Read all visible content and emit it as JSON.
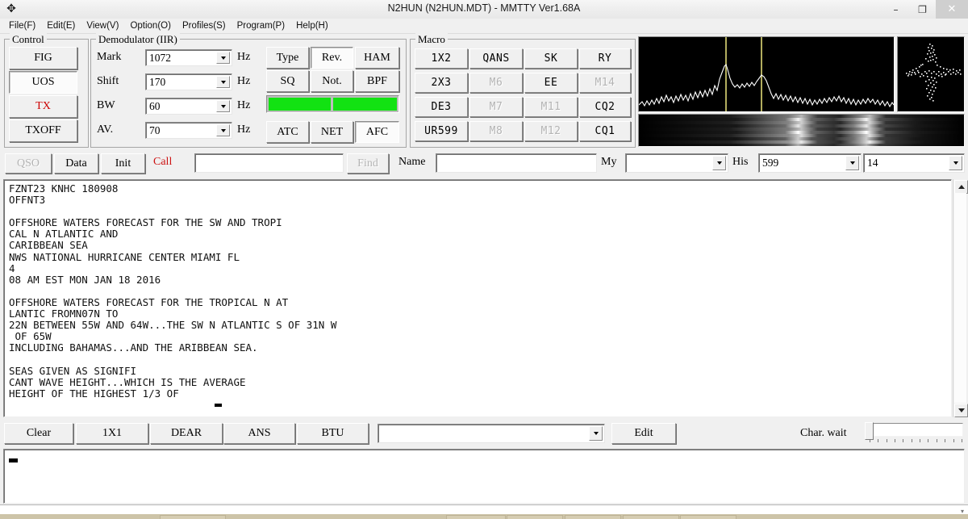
{
  "window": {
    "icon": "move-crosshair-icon",
    "title": "N2HUN (N2HUN.MDT) - MMTTY Ver1.68A",
    "minimize": "–",
    "maximize": "❐",
    "close": "✕"
  },
  "menu": {
    "items": [
      {
        "label": "File(F)"
      },
      {
        "label": "Edit(E)"
      },
      {
        "label": "View(V)"
      },
      {
        "label": "Option(O)"
      },
      {
        "label": "Profiles(S)"
      },
      {
        "label": "Program(P)"
      },
      {
        "label": "Help(H)"
      }
    ]
  },
  "control": {
    "legend": "Control",
    "buttons": [
      {
        "label": "FIG",
        "pressed": false,
        "red": false
      },
      {
        "label": "UOS",
        "pressed": true,
        "red": false
      },
      {
        "label": "TX",
        "pressed": false,
        "red": true
      },
      {
        "label": "TXOFF",
        "pressed": false,
        "red": false
      }
    ]
  },
  "demodulator": {
    "legend": "Demodulator (IIR)",
    "rows": [
      {
        "label": "Mark",
        "value": "1072",
        "unit": "Hz"
      },
      {
        "label": "Shift",
        "value": "170",
        "unit": "Hz"
      },
      {
        "label": "BW",
        "value": "60",
        "unit": "Hz"
      },
      {
        "label": "AV.",
        "value": "70",
        "unit": "Hz"
      }
    ],
    "mode_buttons": [
      {
        "label": "Type",
        "pressed": false
      },
      {
        "label": "Rev.",
        "pressed": true
      },
      {
        "label": "HAM",
        "pressed": false
      },
      {
        "label": "SQ",
        "pressed": false
      },
      {
        "label": "Not.",
        "pressed": false
      },
      {
        "label": "BPF",
        "pressed": false
      }
    ],
    "meter": {
      "name": "tuning-level-meter",
      "color": "#12e212",
      "segments": 2
    },
    "afc_buttons": [
      {
        "label": "ATC",
        "pressed": false
      },
      {
        "label": "NET",
        "pressed": false
      },
      {
        "label": "AFC",
        "pressed": true
      }
    ]
  },
  "macro": {
    "legend": "Macro",
    "buttons": [
      {
        "label": "1X2",
        "disabled": false
      },
      {
        "label": "QANS",
        "disabled": false
      },
      {
        "label": "SK",
        "disabled": false
      },
      {
        "label": "RY",
        "disabled": false
      },
      {
        "label": "2X3",
        "disabled": false
      },
      {
        "label": "M6",
        "disabled": true
      },
      {
        "label": "EE",
        "disabled": false
      },
      {
        "label": "M14",
        "disabled": true
      },
      {
        "label": "DE3",
        "disabled": false
      },
      {
        "label": "M7",
        "disabled": true
      },
      {
        "label": "M11",
        "disabled": true
      },
      {
        "label": "CQ2",
        "disabled": false
      },
      {
        "label": "UR599",
        "disabled": false
      },
      {
        "label": "M8",
        "disabled": true
      },
      {
        "label": "M12",
        "disabled": true
      },
      {
        "label": "CQ1",
        "disabled": false
      }
    ]
  },
  "scope": {
    "spectrum_name": "fft-spectrum-display",
    "waterfall_name": "waterfall-display",
    "xy_name": "xy-scope-display",
    "marker_color": "#b2ad5e",
    "trace_color": "#ffffff",
    "background": "#000000"
  },
  "qsobar": {
    "buttons": [
      {
        "label": "QSO",
        "disabled": true
      },
      {
        "label": "Data",
        "disabled": false
      },
      {
        "label": "Init",
        "disabled": false
      }
    ],
    "call_label": "Call",
    "call_value": "",
    "find_label": "Find",
    "find_disabled": true,
    "name_label": "Name",
    "name_value": "",
    "my_label": "My",
    "my_value": "",
    "his_label": "His",
    "his_value": "599",
    "nr_value": "14"
  },
  "receive": {
    "name": "receive-text-pane",
    "text": "FZNT23 KNHC 180908\nOFFNT3\n\nOFFSHORE WATERS FORECAST FOR THE SW AND TROPI\nCAL N ATLANTIC AND\nCARIBBEAN SEA\nNWS NATIONAL HURRICANE CENTER MIAMI FL\n4\n08 AM EST MON JAN 18 2016\n\nOFFSHORE WATERS FORECAST FOR THE TROPICAL N AT\nLANTIC FROMN07N TO\n22N BETWEEN 55W AND 64W...THE SW N ATLANTIC S OF 31N W\n OF 65W\nINCLUDING BAHAMAS...AND THE ARIBBEAN SEA.\n\nSEAS GIVEN AS SIGNIFI\nCANT WAVE HEIGHT...WHICH IS THE AVERAGE\nHEIGHT OF THE HIGHEST 1/3 OF "
  },
  "bottombar": {
    "buttons": [
      {
        "label": "Clear"
      },
      {
        "label": "1X1"
      },
      {
        "label": "DEAR"
      },
      {
        "label": "ANS"
      },
      {
        "label": "BTU"
      }
    ],
    "macro_select_value": "",
    "edit_label": "Edit",
    "charwait_label": "Char. wait",
    "charwait_value": 0,
    "charwait_ticks": 12
  },
  "transmit": {
    "name": "transmit-text-pane",
    "text": ""
  },
  "statusbar": {
    "text": "",
    "grip": "▾"
  }
}
